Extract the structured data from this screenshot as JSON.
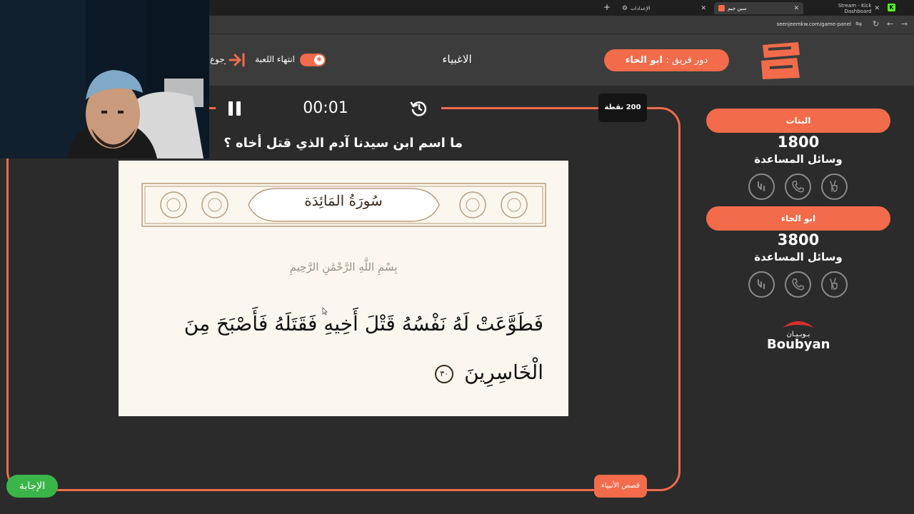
{
  "browser": {
    "tabs": [
      {
        "label": "Stream - Kick Dashboard",
        "favicon": "kick-icon",
        "active": false
      },
      {
        "label": "سين جيم",
        "favicon": "app-icon",
        "active": true
      },
      {
        "label": "الإعدادات",
        "favicon": "gear-icon",
        "active": false
      }
    ],
    "url": "seenjeemkw.com/game-panel"
  },
  "header": {
    "turn_label": "دور فريق :",
    "turn_team": "ابو الحاء",
    "current_team": "الاغبياء",
    "end_game_label": "انتهاء اللعبة",
    "back_label": "الرجوع"
  },
  "board": {
    "timer": "00:01",
    "points": "200 نقطة",
    "question": "ما اسم ابن سيدنا آدم الذي قتل أخاه ؟",
    "category": "قصص الأنبياء",
    "answer_button": "الإجابة",
    "quran": {
      "surah": "سُورَةُ المَائِدَة",
      "bismillah": "بِسْمِ اللَّهِ الرَّحْمَٰنِ الرَّحِيمِ",
      "verse_line1": "فَطَوَّعَتْ لَهُ نَفْسُهُ قَتْلَ أَخِيهِ فَقَتَلَهُ فَأَصْبَحَ مِنَ",
      "verse_line2": "الْخَاسِرِينَ",
      "ayah_number": "٣٠"
    }
  },
  "teams": [
    {
      "name": "البنات",
      "score": "1800",
      "helpers_title": "وسائل المساعدة",
      "helpers": [
        "two-answers-icon",
        "call-icon",
        "rest-icon"
      ]
    },
    {
      "name": "ابو الحاء",
      "score": "3800",
      "helpers_title": "وسائل المساعدة",
      "helpers": [
        "two-answers-icon",
        "call-icon",
        "rest-icon"
      ]
    }
  ],
  "sponsor": {
    "name": "Boubyan",
    "arabic": "بوبيان"
  },
  "colors": {
    "accent": "#f26b4a",
    "answer_green": "#3bb54a",
    "background": "#2b2b2b"
  }
}
